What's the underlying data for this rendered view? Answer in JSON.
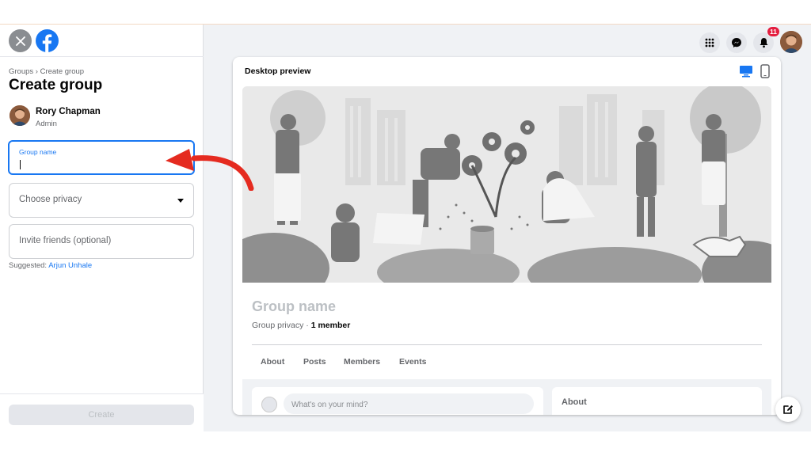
{
  "sidebar": {
    "breadcrumb": "Groups › Create group",
    "title": "Create group",
    "owner": {
      "name": "Rory Chapman",
      "role": "Admin"
    },
    "group_name_field": {
      "label": "Group name",
      "value": ""
    },
    "privacy_select": {
      "value": "Choose privacy"
    },
    "invite_field": {
      "placeholder": "Invite friends (optional)"
    },
    "suggested_label": "Suggested:",
    "suggested_name": "Arjun Unhale",
    "create_label": "Create"
  },
  "nav": {
    "notification_count": "11"
  },
  "preview": {
    "title": "Desktop preview",
    "group_name": "Group name",
    "privacy": "Group privacy · ",
    "members": "1 member",
    "tabs": [
      "About",
      "Posts",
      "Members",
      "Events"
    ],
    "composer_placeholder": "What's on your mind?",
    "about_heading": "About"
  },
  "icons": {
    "close": "close-icon",
    "logo": "facebook-logo-icon",
    "menu": "grid-menu-icon",
    "messenger": "messenger-icon",
    "bell": "bell-icon",
    "desktop": "desktop-icon",
    "mobile": "mobile-icon",
    "compose": "compose-icon"
  },
  "colors": {
    "accent": "#1877f2",
    "annotation_arrow": "#e52b20",
    "badge": "#e41e3f"
  }
}
